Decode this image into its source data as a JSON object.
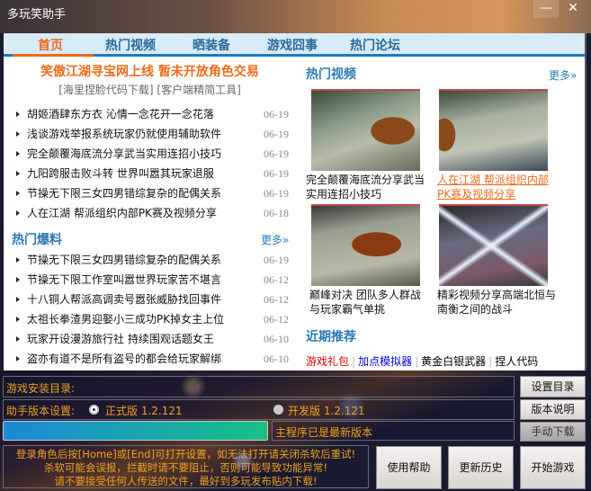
{
  "window": {
    "title": "多玩笑助手",
    "minimize": "—",
    "close": "✕"
  },
  "tabs": [
    {
      "label": "首页"
    },
    {
      "label": "热门视频"
    },
    {
      "label": "晒装备"
    },
    {
      "label": "游戏囧事"
    },
    {
      "label": "热门论坛"
    }
  ],
  "home": {
    "headline": "笑傲江湖寻宝网上线  暂未开放角色交易",
    "subline": "[海里捏脸代码下载] [客户端精简工具]",
    "news": [
      {
        "title": "胡姬酒肆东方衣  沁情一念花开一念花落",
        "date": "06-19"
      },
      {
        "title": "浅谈游戏举报系统玩家仍就使用辅助软件",
        "date": "06-19"
      },
      {
        "title": "完全颠覆海底流分享武当实用连招小技巧",
        "date": "06-19"
      },
      {
        "title": "九阳跨服击败斗转  世界叫嚣其玩家退服",
        "date": "06-19"
      },
      {
        "title": "节操无下限三女四男错综复杂的配偶关系",
        "date": "06-19"
      },
      {
        "title": "人在江湖  帮派组织内部PK赛及视频分享",
        "date": "06-18"
      }
    ],
    "hot_news": {
      "title": "热门爆料",
      "more": "更多»",
      "items": [
        {
          "title": "节操无下限三女四男错综复杂的配偶关系",
          "date": "06-19"
        },
        {
          "title": "节操无下限工作室叫嚣世界玩家苦不堪言",
          "date": "06-12"
        },
        {
          "title": "十八铜人帮派高调卖号嚣张威胁找回事件",
          "date": "06-12"
        },
        {
          "title": "太祖长拳渣男迎娶小三成功PK掉女主上位",
          "date": "06-12"
        },
        {
          "title": "玩家开设漫游旅行社  持续围观话题女王",
          "date": "06-10"
        },
        {
          "title": "盗亦有道不是所有盗号的都会给玩家解绑",
          "date": "06-10"
        }
      ]
    },
    "hot_videos": {
      "title": "热门视频",
      "more": "更多»",
      "items": [
        {
          "caption": "完全颠覆海底流分享武当实用连招小技巧"
        },
        {
          "caption": "人在江湖 帮派组织内部PK赛及视频分享"
        },
        {
          "caption": "巅峰对决  团队多人群战与玩家霸气单挑"
        },
        {
          "caption": "精彩视频分享高端北恒与南衡之间的战斗"
        }
      ]
    },
    "recommend": {
      "title": "近期推荐",
      "links": [
        {
          "label": "游戏礼包",
          "color": "#e00000"
        },
        {
          "label": "加点模拟器",
          "color": "#0000e0"
        },
        {
          "label": "黄金白银武器",
          "color": "#111111"
        },
        {
          "label": "捏人代码",
          "color": "#111111"
        }
      ]
    }
  },
  "bottom": {
    "install_dir_label": "游戏安装目录:",
    "install_dir_value": "",
    "set_dir_button": "设置目录",
    "version_label": "助手版本设置:",
    "release_option": "正式版 1.2.121",
    "dev_option": "开发版 1.2.121",
    "selected": "release",
    "version_notes_button": "版本说明",
    "progress_percent": 100,
    "status": "主程序已是最新版本",
    "manual_download_button": "手动下载",
    "notice": [
      "登录角色后按[Home]或[End]可打开设置，如无法打开请关闭杀软后重试!",
      "杀软可能会误报，拦截时请不要阻止，否则可能导致功能异常!",
      "请不要接受任何人传送的文件，最好到多玩发布贴内下载!"
    ],
    "help_button": "使用帮助",
    "history_button": "更新历史",
    "start_button": "开始游戏"
  }
}
